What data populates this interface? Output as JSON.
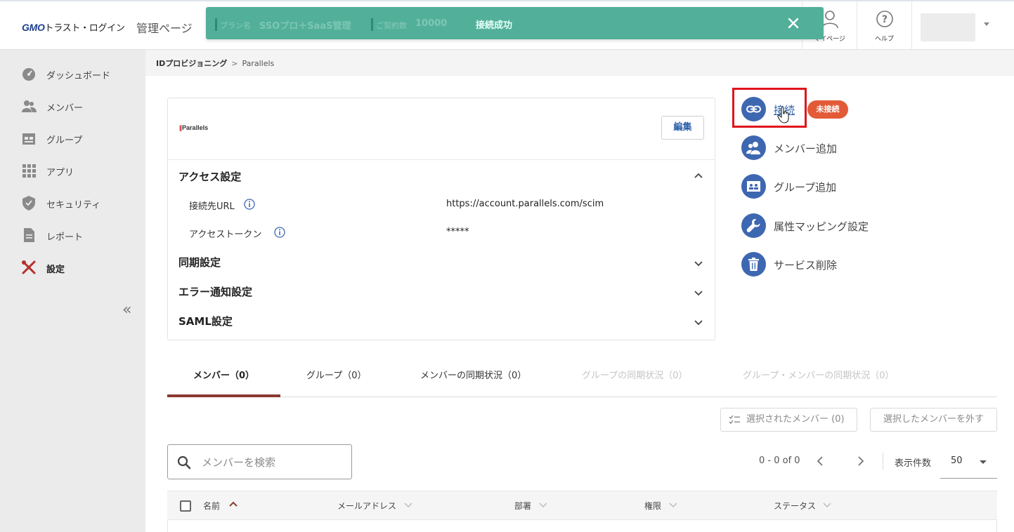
{
  "header": {
    "logo_brand": "GMO",
    "logo_text": "トラスト・ログイン",
    "admin_title": "管理ページ",
    "mypage_label": "マイページ",
    "help_label": "ヘルプ"
  },
  "toast": {
    "plan_key": "プラン名",
    "plan_value": "SSOプロ＋SaaS管理",
    "contract_key": "ご契約数",
    "contract_value": "10000",
    "message": "接続成功"
  },
  "sidebar": {
    "items": [
      {
        "label": "ダッシュボード",
        "icon": "dashboard-icon"
      },
      {
        "label": "メンバー",
        "icon": "members-icon"
      },
      {
        "label": "グループ",
        "icon": "groups-icon"
      },
      {
        "label": "アプリ",
        "icon": "apps-icon"
      },
      {
        "label": "セキュリティ",
        "icon": "shield-icon"
      },
      {
        "label": "レポート",
        "icon": "report-icon"
      },
      {
        "label": "設定",
        "icon": "settings-tools-icon"
      }
    ],
    "collapse_glyph": "«"
  },
  "breadcrumb": {
    "parent": "IDプロビジョニング",
    "separator": ">",
    "current": "Parallels"
  },
  "service": {
    "logo_text": "Parallels",
    "edit_label": "編集",
    "access_title": "アクセス設定",
    "url_key": "接続先URL",
    "url_value": "https://account.parallels.com/scim",
    "token_key": "アクセストークン",
    "token_value": "*****",
    "sync_title": "同期設定",
    "error_title": "エラー通知設定",
    "saml_title": "SAML設定"
  },
  "actions": {
    "connect": "接続",
    "status_badge": "未接続",
    "add_member": "メンバー追加",
    "add_group": "グループ追加",
    "attr_mapping": "属性マッピング設定",
    "delete_service": "サービス削除"
  },
  "tabs": [
    {
      "label": "メンバー（0）",
      "state": "active"
    },
    {
      "label": "グループ（0）",
      "state": "normal"
    },
    {
      "label": "メンバーの同期状況（0）",
      "state": "normal"
    },
    {
      "label": "グループの同期状況（0）",
      "state": "disabled"
    },
    {
      "label": "グループ・メンバーの同期状況（0）",
      "state": "disabled"
    }
  ],
  "toolbar": {
    "selected_members": "選択されたメンバー (0)",
    "remove_selected": "選択したメンバーを外す"
  },
  "search": {
    "placeholder": "メンバーを検索"
  },
  "pagination": {
    "range": "0 - 0 of 0",
    "per_page_label": "表示件数",
    "per_page_value": "50"
  },
  "table": {
    "columns": [
      "名前",
      "メールアドレス",
      "部署",
      "権限",
      "ステータス"
    ]
  },
  "colors": {
    "toast_bg": "#52b09a",
    "action_icon_bg": "#3e67b1",
    "badge_bg": "#e35a38",
    "highlight_border": "#e0141c",
    "tab_underline": "#8b3a32"
  }
}
